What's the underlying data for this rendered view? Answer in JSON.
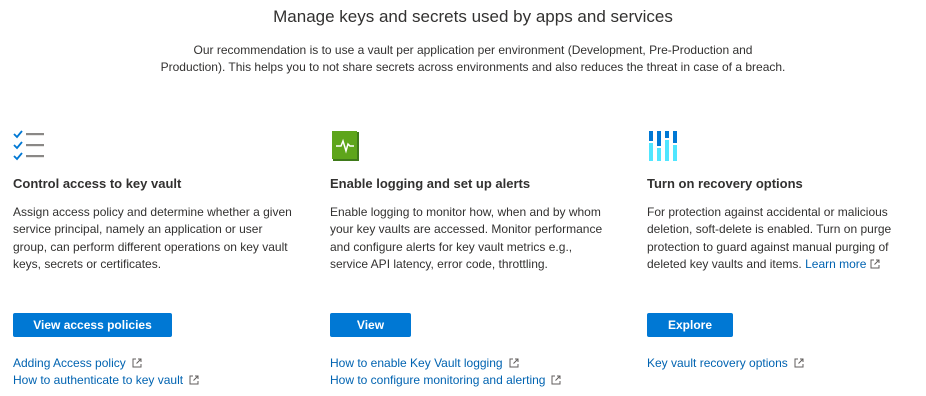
{
  "title": "Manage keys and secrets used by apps and services",
  "subtitle": "Our recommendation is to use a vault per application per environment (Development, Pre-Production and Production). This helps you to not share secrets across environments and also reduces the threat in case of a breach.",
  "cards": [
    {
      "icon": "checklist-icon",
      "heading": "Control access to key vault",
      "description": "Assign access policy and determine whether a given service principal, namely an application or user group, can perform different operations on key vault keys, secrets or certificates.",
      "button": "View access policies",
      "links": [
        "Adding Access policy",
        "How to authenticate to key vault"
      ]
    },
    {
      "icon": "logging-book-icon",
      "heading": "Enable logging and set up alerts",
      "description": "Enable logging to monitor how, when and by whom your key vaults are accessed. Monitor performance and configure alerts for key vault metrics e.g., service API latency, error code, throttling.",
      "button": "View",
      "links": [
        "How to enable Key Vault logging",
        "How to configure monitoring and alerting"
      ]
    },
    {
      "icon": "recovery-bars-icon",
      "heading": "Turn on recovery options",
      "description": "For protection against accidental or malicious deletion, soft-delete is enabled. Turn on purge protection to guard against manual purging of deleted key vaults and items.",
      "learn_more": "Learn more",
      "button": "Explore",
      "links": [
        "Key vault recovery options"
      ]
    }
  ],
  "colors": {
    "accent": "#0078d4",
    "link": "#0063b1",
    "text": "#323130",
    "icon_green": "#5ea51b"
  }
}
